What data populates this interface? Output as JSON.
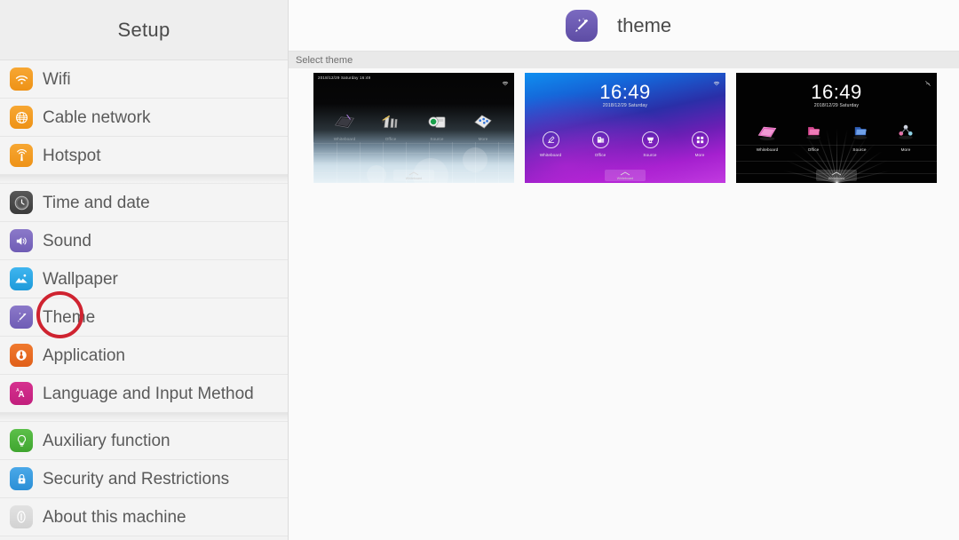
{
  "sidebar": {
    "header_title": "Setup",
    "groups": [
      {
        "items": [
          {
            "label": "Wifi",
            "icon": "wifi-icon",
            "color": "#ee9216"
          },
          {
            "label": "Cable network",
            "icon": "ethernet-globe-icon",
            "color": "#ee9216"
          },
          {
            "label": "Hotspot",
            "icon": "hotspot-antenna-icon",
            "color": "#ee9216"
          }
        ]
      },
      {
        "items": [
          {
            "label": "Time and date",
            "icon": "clock-icon",
            "color": "#3b3b3b"
          },
          {
            "label": "Sound",
            "icon": "speaker-icon",
            "color": "#6f5cb5"
          },
          {
            "label": "Wallpaper",
            "icon": "mountain-image-icon",
            "color": "#1d9ada"
          },
          {
            "label": "Theme",
            "icon": "magic-wand-icon",
            "color": "#6f5cb5"
          },
          {
            "label": "Application",
            "icon": "application-icon",
            "color": "#e0601a"
          },
          {
            "label": "Language and Input Method",
            "icon": "language-a-icon",
            "color": "#c21f7d"
          }
        ]
      },
      {
        "items": [
          {
            "label": "Auxiliary function",
            "icon": "lightbulb-icon",
            "color": "#3fa52f"
          },
          {
            "label": "Security and Restrictions",
            "icon": "lock-icon",
            "color": "#2b8fd6"
          },
          {
            "label": "About this machine",
            "icon": "info-icon",
            "color": "#d2d2d2"
          }
        ]
      }
    ]
  },
  "main": {
    "header_title": "theme",
    "header_icon": "magic-wand-icon",
    "section_label": "Select theme",
    "themes": [
      {
        "name": "theme-classic-horizon",
        "status_text": "2018/12/29 Saturday   16:49",
        "show_status_bar": true,
        "show_clock": false,
        "wifi_icon": "wifi-icon",
        "apps": [
          {
            "label": "Whiteboard",
            "icon": "whiteboard-icon"
          },
          {
            "label": "Office",
            "icon": "office-icon"
          },
          {
            "label": "Source",
            "icon": "source-icon"
          },
          {
            "label": "More",
            "icon": "more-apps-icon"
          }
        ],
        "dock_label": "Whiteboard"
      },
      {
        "name": "theme-blue-purple",
        "show_status_bar": false,
        "show_clock": true,
        "time": "16:49",
        "date": "2018/12/29 Saturday",
        "wifi_icon": "wifi-icon",
        "apps": [
          {
            "label": "Whiteboard",
            "icon": "whiteboard-icon"
          },
          {
            "label": "Office",
            "icon": "office-icon"
          },
          {
            "label": "Source",
            "icon": "source-icon"
          },
          {
            "label": "More",
            "icon": "more-apps-icon"
          }
        ],
        "dock_label": "Whiteboard"
      },
      {
        "name": "theme-black-grid",
        "show_status_bar": false,
        "show_clock": true,
        "time": "16:49",
        "date": "2018/12/29 Saturday",
        "wifi_icon": "wifi-off-icon",
        "apps": [
          {
            "label": "Whiteboard",
            "icon": "whiteboard-icon"
          },
          {
            "label": "Office",
            "icon": "office-icon"
          },
          {
            "label": "Source",
            "icon": "source-icon"
          },
          {
            "label": "More",
            "icon": "more-apps-icon"
          }
        ],
        "dock_label": "Whiteboard"
      }
    ]
  },
  "annotation": {
    "type": "circle-highlight",
    "target": "Theme",
    "color": "#cf2330"
  }
}
